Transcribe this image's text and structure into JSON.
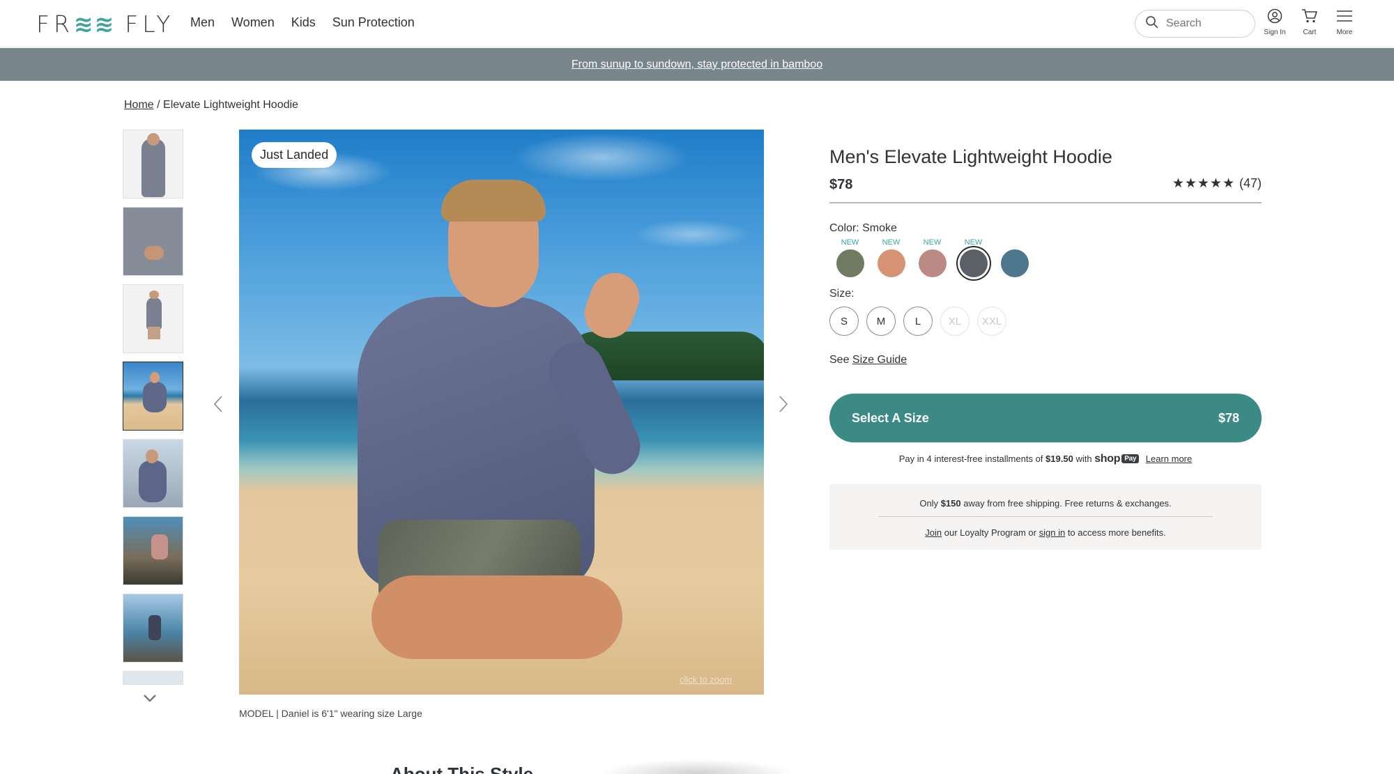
{
  "brand": {
    "logo_left": "FR",
    "logo_wave": "≋≋",
    "logo_right": "FLY"
  },
  "nav": {
    "items": [
      "Men",
      "Women",
      "Kids",
      "Sun Protection"
    ]
  },
  "header": {
    "search_placeholder": "Search",
    "sign_in": "Sign In",
    "cart": "Cart",
    "more": "More"
  },
  "promo": {
    "text": "From sunup to sundown, stay protected in bamboo"
  },
  "breadcrumb": {
    "home": "Home",
    "separator": "/",
    "current": "Elevate Lightweight Hoodie"
  },
  "gallery": {
    "badge": "Just Landed",
    "zoom_hint": "click to zoom",
    "caption": "MODEL | Daniel is 6'1\" wearing size Large",
    "thumb_count": 8,
    "selected_thumb": 4
  },
  "product": {
    "title": "Men's Elevate Lightweight Hoodie",
    "price": "$78",
    "stars": "★★★★★",
    "review_count": "(47)",
    "color_label": "Color: Smoke",
    "swatches": [
      {
        "tag": "NEW",
        "color": "#707b62",
        "selected": false
      },
      {
        "tag": "NEW",
        "color": "#d69474",
        "selected": false
      },
      {
        "tag": "NEW",
        "color": "#bb8a84",
        "selected": false
      },
      {
        "tag": "NEW",
        "color": "#5b5f66",
        "selected": true
      },
      {
        "tag": "",
        "color": "#4f7690",
        "selected": false
      }
    ],
    "size_label": "Size:",
    "sizes": [
      {
        "label": "S",
        "available": true
      },
      {
        "label": "M",
        "available": true
      },
      {
        "label": "L",
        "available": true
      },
      {
        "label": "XL",
        "available": false
      },
      {
        "label": "XXL",
        "available": false
      }
    ],
    "size_guide_prefix": "See",
    "size_guide_link": "Size Guide",
    "cta_label": "Select A Size",
    "cta_price": "$78",
    "installments": {
      "pre": "Pay in 4 interest-free installments of",
      "amount": "$19.50",
      "with": "with",
      "shop": "shop",
      "pay": "Pay",
      "learn_more": "Learn more"
    },
    "shipping": {
      "pre": "Only",
      "amount": "$150",
      "post": "away from free shipping. Free returns & exchanges.",
      "join": "Join",
      "mid": "our Loyalty Program or",
      "sign_in": "sign in",
      "end": "to access more benefits."
    }
  },
  "below_fold": {
    "heading": "About This Style"
  },
  "colors": {
    "accent": "#3b8a85",
    "promo_bg": "#78868c",
    "teal": "#3aa5a0"
  }
}
